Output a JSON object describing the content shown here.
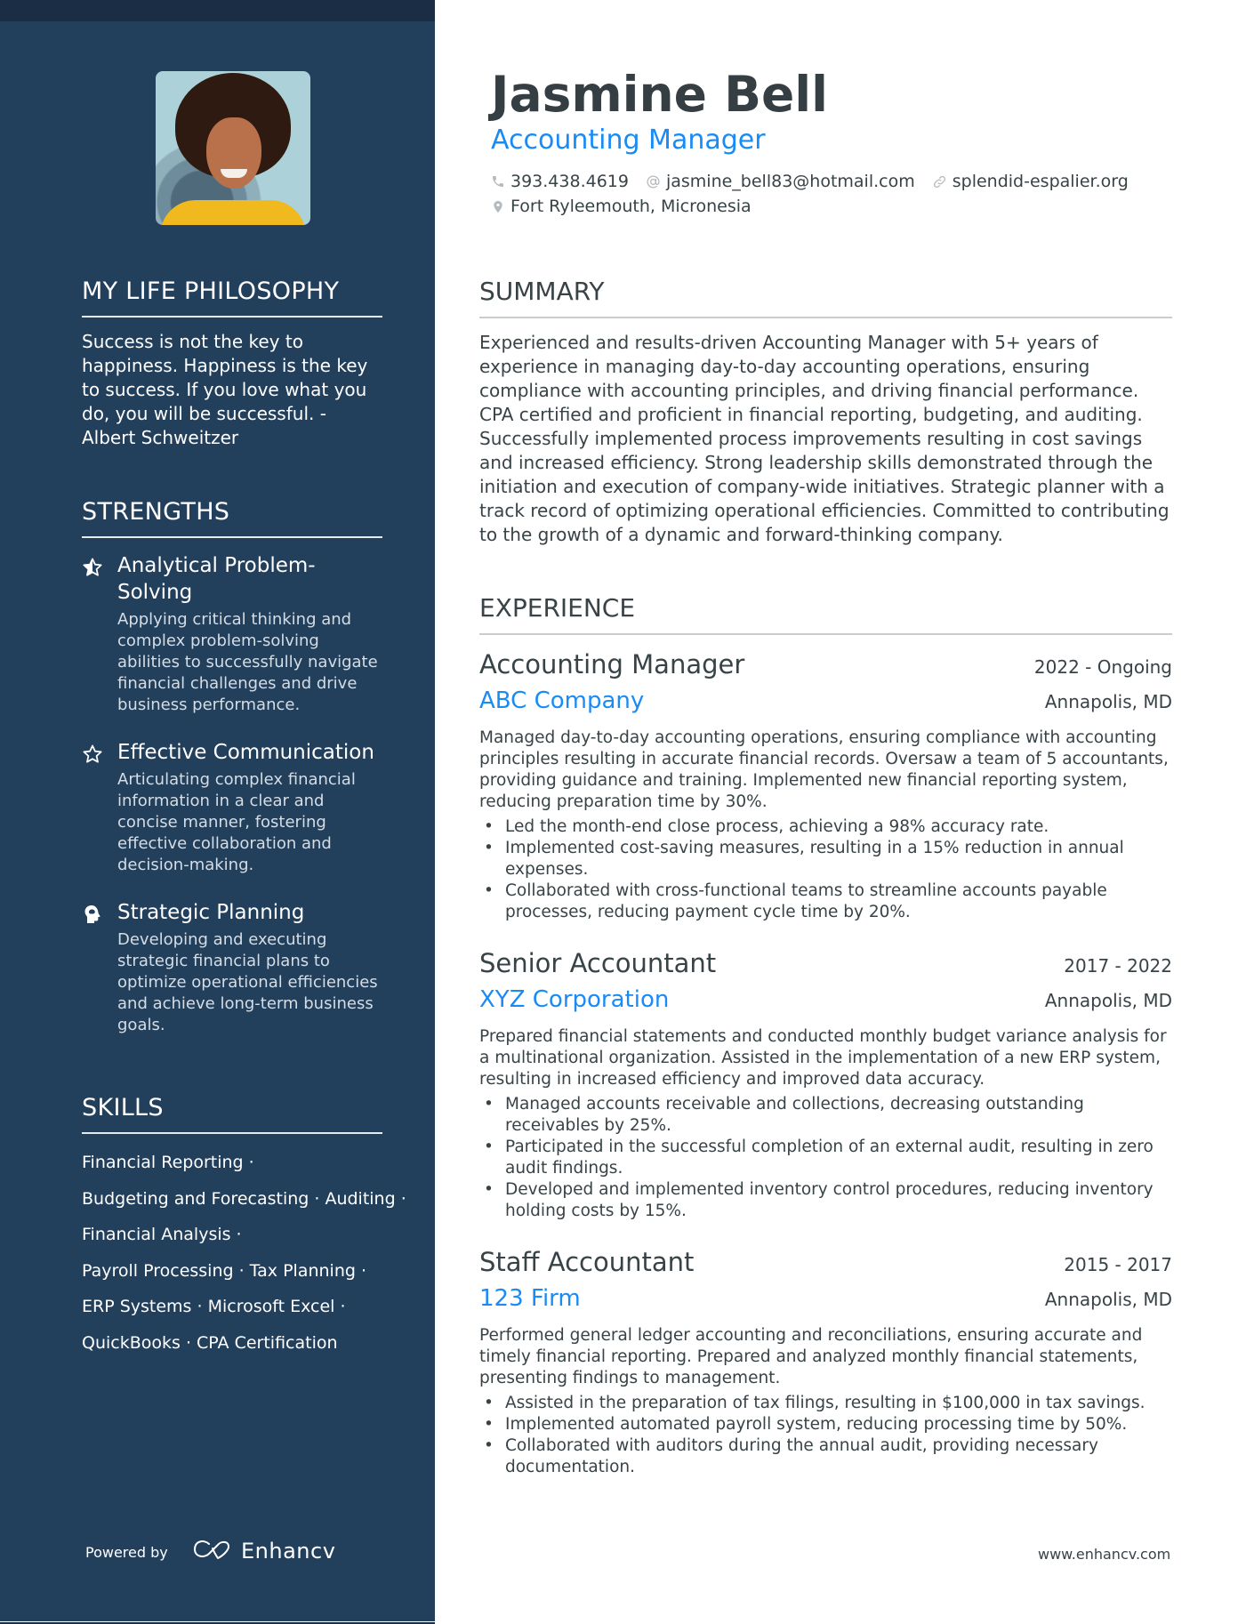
{
  "profile": {
    "name": "Jasmine Bell",
    "title": "Accounting Manager",
    "photo_alt": "Profile photo of Jasmine Bell",
    "contacts": {
      "phone": "393.438.4619",
      "email": "jasmine_bell83@hotmail.com",
      "website": "splendid-espalier.org",
      "location": "Fort Ryleemouth, Micronesia"
    }
  },
  "sidebar": {
    "philosophy": {
      "heading": "MY LIFE PHILOSOPHY",
      "text": "Success is not the key to happiness. Happiness is the key to success. If you love what you do, you will be successful. - Albert Schweitzer"
    },
    "strengths": {
      "heading": "STRENGTHS",
      "items": [
        {
          "icon": "star-half-icon",
          "title": "Analytical Problem-Solving",
          "description": "Applying critical thinking and complex problem-solving abilities to successfully navigate financial challenges and drive business performance."
        },
        {
          "icon": "star-outline-icon",
          "title": "Effective Communication",
          "description": "Articulating complex financial information in a clear and concise manner, fostering effective collaboration and decision-making."
        },
        {
          "icon": "head-brain-icon",
          "title": "Strategic Planning",
          "description": "Developing and executing strategic financial plans to optimize operational efficiencies and achieve long-term business goals."
        }
      ]
    },
    "skills": {
      "heading": "SKILLS",
      "lines": [
        "Financial Reporting ·",
        "Budgeting and Forecasting · Auditing ·",
        "Financial Analysis ·",
        "Payroll Processing · Tax Planning ·",
        "ERP Systems · Microsoft Excel ·",
        "QuickBooks · CPA Certification"
      ]
    },
    "footer": {
      "powered_by": "Powered by",
      "brand": "Enhancv"
    }
  },
  "summary": {
    "heading": "SUMMARY",
    "text": "Experienced and results-driven Accounting Manager with 5+ years of experience in managing day-to-day accounting operations, ensuring compliance with accounting principles, and driving financial performance. CPA certified and proficient in financial reporting, budgeting, and auditing. Successfully implemented process improvements resulting in cost savings and increased efficiency. Strong leadership skills demonstrated through the initiation and execution of company-wide initiatives. Strategic planner with a track record of optimizing operational efficiencies. Committed to contributing to the growth of a dynamic and forward-thinking company."
  },
  "experience": {
    "heading": "EXPERIENCE",
    "jobs": [
      {
        "title": "Accounting Manager",
        "dates": "2022 - Ongoing",
        "company": "ABC Company",
        "location": "Annapolis, MD",
        "description": "Managed day-to-day accounting operations, ensuring compliance with accounting principles resulting in accurate financial records. Oversaw a team of 5 accountants, providing guidance and training. Implemented new financial reporting system, reducing preparation time by 30%.",
        "bullets": [
          "Led the month-end close process, achieving a 98% accuracy rate.",
          "Implemented cost-saving measures, resulting in a 15% reduction in annual expenses.",
          "Collaborated with cross-functional teams to streamline accounts payable processes, reducing payment cycle time by 20%."
        ]
      },
      {
        "title": "Senior Accountant",
        "dates": "2017 - 2022",
        "company": "XYZ Corporation",
        "location": "Annapolis, MD",
        "description": "Prepared financial statements and conducted monthly budget variance analysis for a multinational organization. Assisted in the implementation of a new ERP system, resulting in increased efficiency and improved data accuracy.",
        "bullets": [
          "Managed accounts receivable and collections, decreasing outstanding receivables by 25%.",
          "Participated in the successful completion of an external audit, resulting in zero audit findings.",
          "Developed and implemented inventory control procedures, reducing inventory holding costs by 15%."
        ]
      },
      {
        "title": "Staff Accountant",
        "dates": "2015 - 2017",
        "company": "123 Firm",
        "location": "Annapolis, MD",
        "description": "Performed general ledger accounting and reconciliations, ensuring accurate and timely financial reporting. Prepared and analyzed monthly financial statements, presenting findings to management.",
        "bullets": [
          "Assisted in the preparation of tax filings, resulting in $100,000 in tax savings.",
          "Implemented automated payroll system, reducing processing time by 50%.",
          "Collaborated with auditors during the annual audit, providing necessary documentation."
        ]
      }
    ]
  },
  "footer": {
    "url": "www.enhancv.com"
  },
  "colors": {
    "sidebar_bg": "#223f5c",
    "sidebar_top_band": "#1b2d44",
    "accent_blue": "#1a8bf5",
    "text_dark": "#384347",
    "name_color": "#343e43",
    "divider": "#c9cdd0"
  }
}
